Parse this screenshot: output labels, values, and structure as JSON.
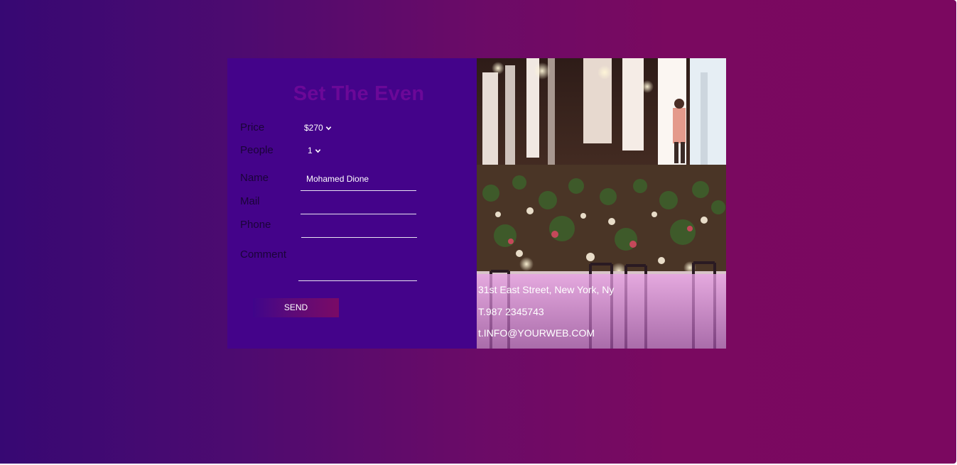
{
  "form": {
    "title": "Set The Even",
    "price_label": "Price",
    "price_value": "$270",
    "people_label": "People",
    "people_value": "1",
    "name_label": "Name",
    "name_value": "Mohamed Dione",
    "mail_label": "Mail",
    "mail_value": "",
    "phone_label": "Phone",
    "phone_value": "",
    "comment_label": "Comment",
    "comment_value": "",
    "send_label": "SEND"
  },
  "contact": {
    "address": "31st East Street, New York, Ny",
    "phone": "T.987 2345743",
    "email": "t.INFO@YOURWEB.COM"
  },
  "colors": {
    "background_left": "#370873",
    "background_right": "#7b0860",
    "form_panel": "#44038a",
    "title": "#6b0898",
    "overlay": "#c27bc8"
  },
  "icons": {
    "select_arrow": "chevron-down-icon",
    "photo": "banquet-hall-photo"
  }
}
